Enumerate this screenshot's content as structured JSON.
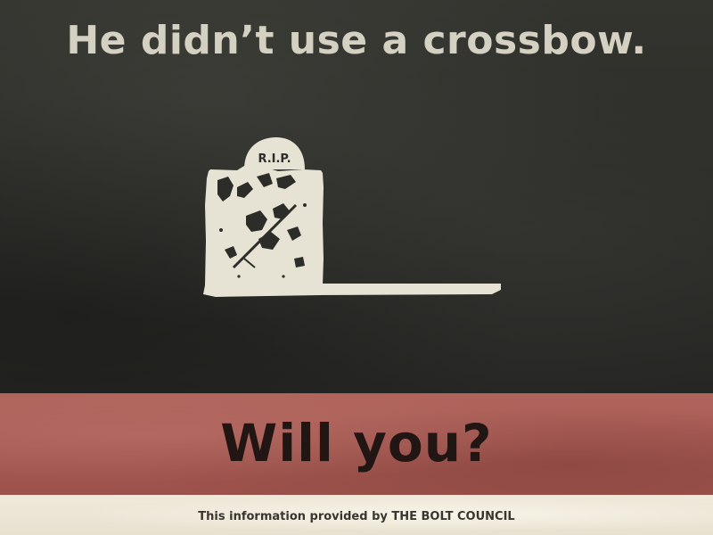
{
  "headline": "He didn’t use a crossbow.",
  "graphic": {
    "icon": "tombstone-icon",
    "inscription": "R.I.P."
  },
  "banner": {
    "text": "Will you?"
  },
  "footer": {
    "text": "This information provided by THE BOLT COUNCIL"
  },
  "colors": {
    "background": "#2c2c29",
    "headline": "#d4d0c2",
    "tombstone": "#e6e2d4",
    "banner": "#a65a53",
    "banner_text": "#211614",
    "footer": "#ebe4d4"
  }
}
